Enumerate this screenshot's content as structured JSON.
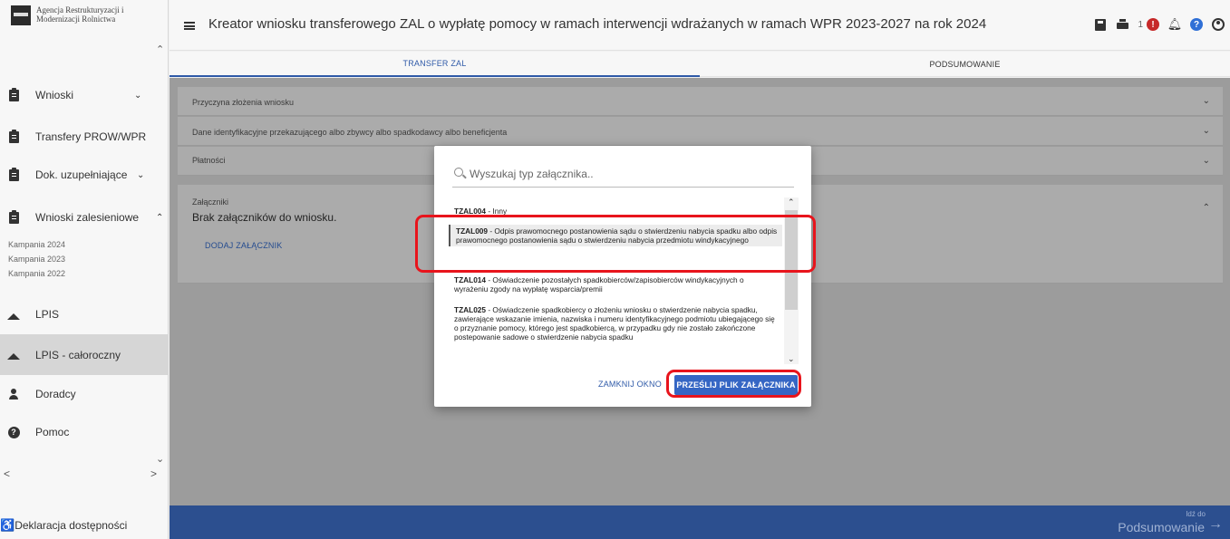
{
  "logo": {
    "text": "Agencja Restrukturyzacji i Modernizacji Rolnictwa"
  },
  "sidebar": {
    "items": [
      {
        "label": "Wnioski",
        "icon": "clipboard-icon"
      },
      {
        "label": "Transfery PROW/WPR",
        "icon": "clipboard-icon"
      },
      {
        "label": "Dok. uzupełniające",
        "icon": "clipboard-icon"
      },
      {
        "label": "Wnioski zalesieniowe",
        "icon": "clipboard-icon"
      },
      {
        "label": "LPIS",
        "icon": "mountain-icon"
      },
      {
        "label": "LPIS - całoroczny",
        "icon": "mountain-icon"
      },
      {
        "label": "Doradcy",
        "icon": "person-icon"
      },
      {
        "label": "Pomoc",
        "icon": "help-icon"
      }
    ],
    "campaigns": [
      "Kampania 2024",
      "Kampania 2023",
      "Kampania 2022"
    ],
    "footer": "Deklaracja dostępności"
  },
  "header": {
    "title": "Kreator wniosku transferowego ZAL o wypłatę pomocy w ramach interwencji wdrażanych w ramach WPR 2023-2027 na rok 2024",
    "notification_count": "1"
  },
  "tabs": [
    "TRANSFER ZAL",
    "PODSUMOWANIE"
  ],
  "panels": {
    "p1": "Przyczyna złożenia wniosku",
    "p2": "Dane identyfikacyjne przekazującego albo zbywcy albo spadkodawcy albo beneficjenta",
    "p3": "Płatności",
    "p4": "Załączniki",
    "p4_sub": "Brak załączników do wniosku.",
    "p4_link": "DODAJ ZAŁĄCZNIK"
  },
  "bottom": {
    "small": "Idź do",
    "main": "Podsumowanie"
  },
  "modal": {
    "search_placeholder": "Wyszukaj typ załącznika..",
    "options": [
      {
        "code": "TZAL004",
        "text": " - Inny"
      },
      {
        "code": "TZAL009",
        "text": " - Odpis prawomocnego postanowienia sądu o stwierdzeniu nabycia spadku albo odpis prawomocnego postanowienia sądu o stwierdzeniu nabycia przedmiotu windykacyjnego"
      },
      {
        "code": "TZAL014",
        "text": " - Oświadczenie pozostałych spadkobierców/zapisobierców windykacyjnych o wyrażeniu zgody na wypłatę wsparcia/premii"
      },
      {
        "code": "TZAL025",
        "text": " - Oświadczenie spadkobiercy o złożeniu wniosku o stwierdzenie nabycia spadku, zawierające wskazanie imienia, nazwiska i numeru identyfikacyjnego podmiotu ubiegającego się o przyznanie pomocy, którego jest spadkobiercą, w przypadku gdy nie zostało zakończone postepowanie sadowe o stwierdzenie nabycia spadku"
      }
    ],
    "close_label": "ZAMKNIJ OKNO",
    "send_label": "PRZEŚLIJ PLIK ZAŁĄCZNIKA"
  },
  "colors": {
    "accent": "#2f5aa8",
    "primary_button": "#3566c4",
    "bottom_bar": "#2c4f8f",
    "highlight": "#e8141c",
    "alert": "#c62828"
  }
}
